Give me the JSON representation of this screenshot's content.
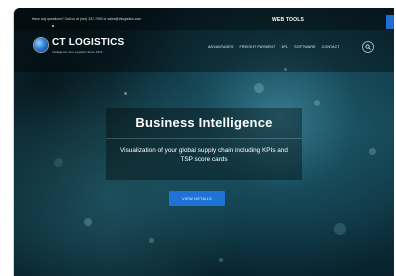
{
  "topbar": {
    "contact": "Have any questions? Call us at (xxx) 337-7000 or sales@ctlogistics.com",
    "tools_label": "WEB TOOLS"
  },
  "brand": {
    "name": "CT LOGISTICS",
    "tagline": "Intelligence Your Logistics Since 1923"
  },
  "nav": {
    "items": [
      "ADVANTAGES",
      "FREIGHT PAYMENT",
      "3PL",
      "SOFTWARE",
      "CONTACT"
    ]
  },
  "hero": {
    "title": "Business Intelligence",
    "subtitle": "Visualization of your global supply chain including KPIs and TSP score cards",
    "cta_label": "VIEW DETAILS"
  },
  "colors": {
    "accent": "#1f72d6",
    "overlay": "#000000"
  },
  "icons": {
    "search": "search-icon",
    "logo": "globe-logo-icon"
  }
}
